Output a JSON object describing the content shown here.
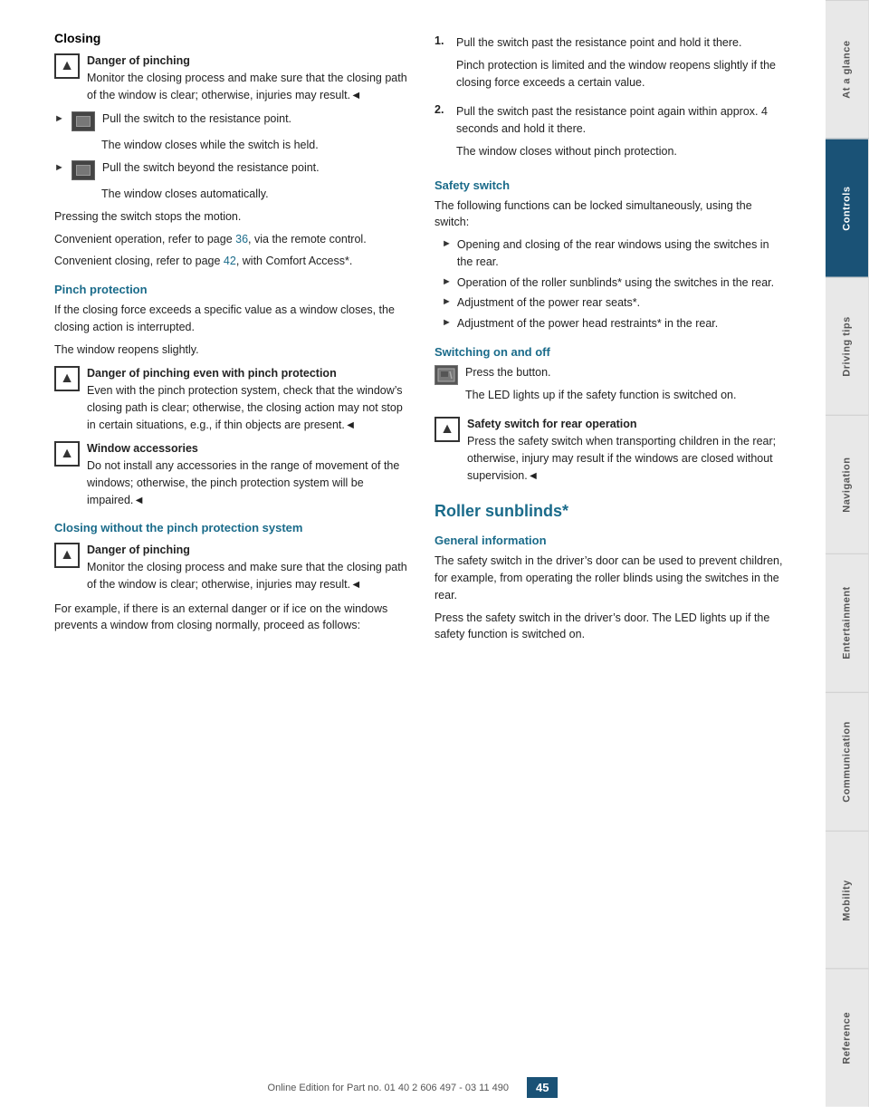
{
  "page": {
    "number": "45",
    "footer_text": "Online Edition for Part no. 01 40 2 606 497 - 03 11 490"
  },
  "sidebar": {
    "tabs": [
      {
        "label": "At a glance",
        "active": false
      },
      {
        "label": "Controls",
        "active": true
      },
      {
        "label": "Driving tips",
        "active": false
      },
      {
        "label": "Navigation",
        "active": false
      },
      {
        "label": "Entertainment",
        "active": false
      },
      {
        "label": "Communication",
        "active": false
      },
      {
        "label": "Mobility",
        "active": false
      },
      {
        "label": "Reference",
        "active": false
      }
    ]
  },
  "left": {
    "main_title": "Closing",
    "warning1": {
      "title": "Danger of pinching",
      "body": "Monitor the closing process and make sure that the closing path of the window is clear; otherwise, injuries may result.◄"
    },
    "action1_text": "Pull the switch to the resistance point.",
    "action1_sub": "The window closes while the switch is held.",
    "action2_text": "Pull the switch beyond the resistance point.",
    "action2_sub": "The window closes automatically.",
    "para1": "Pressing the switch stops the motion.",
    "para2": "Convenient operation, refer to page 36, via the remote control.",
    "para2_link": "36",
    "para3": "Convenient closing, refer to page 42, with Comfort Access*.",
    "para3_link": "42",
    "pinch_title": "Pinch protection",
    "pinch_para1": "If the closing force exceeds a specific value as a window closes, the closing action is interrupted.",
    "pinch_para2": "The window reopens slightly.",
    "warning2": {
      "title": "Danger of pinching even with pinch protection",
      "body": "Even with the pinch protection system, check that the window’s closing path is clear; otherwise, the closing action may not stop in certain situations, e.g., if thin objects are present.◄"
    },
    "warning3": {
      "title": "Window accessories",
      "body": "Do not install any accessories in the range of movement of the windows; otherwise, the pinch protection system will be impaired.◄"
    },
    "closing_no_pinch_title": "Closing without the pinch protection system",
    "warning4": {
      "title": "Danger of pinching",
      "body": "Monitor the closing process and make sure that the closing path of the window is clear; otherwise, injuries may result.◄"
    },
    "closing_para": "For example, if there is an external danger or if ice on the windows prevents a window from closing normally, proceed as follows:"
  },
  "right": {
    "numbered_items": [
      {
        "num": "1.",
        "text": "Pull the switch past the resistance point and hold it there.",
        "sub": "Pinch protection is limited and the window reopens slightly if the closing force exceeds a certain value."
      },
      {
        "num": "2.",
        "text": "Pull the switch past the resistance point again within approx. 4 seconds and hold it there.",
        "sub": "The window closes without pinch protection."
      }
    ],
    "safety_title": "Safety switch",
    "safety_para": "The following functions can be locked simultaneously, using the switch:",
    "safety_bullets": [
      "Opening and closing of the rear windows using the switches in the rear.",
      "Operation of the roller sunblinds* using the switches in the rear.",
      "Adjustment of the power rear seats*.",
      "Adjustment of the power head restraints* in the rear."
    ],
    "switching_title": "Switching on and off",
    "switching_action": "Press the button.",
    "switching_sub": "The LED lights up if the safety function is switched on.",
    "warning5": {
      "title": "Safety switch for rear operation",
      "body": "Press the safety switch when transporting children in the rear; otherwise, injury may result if the windows are closed without supervision.◄"
    },
    "roller_title": "Roller sunblinds*",
    "general_info_title": "General information",
    "general_para1": "The safety switch in the driver’s door can be used to prevent children, for example, from operating the roller blinds using the switches in the rear.",
    "general_para2": "Press the safety switch in the driver’s door. The LED lights up if the safety function is switched on."
  }
}
